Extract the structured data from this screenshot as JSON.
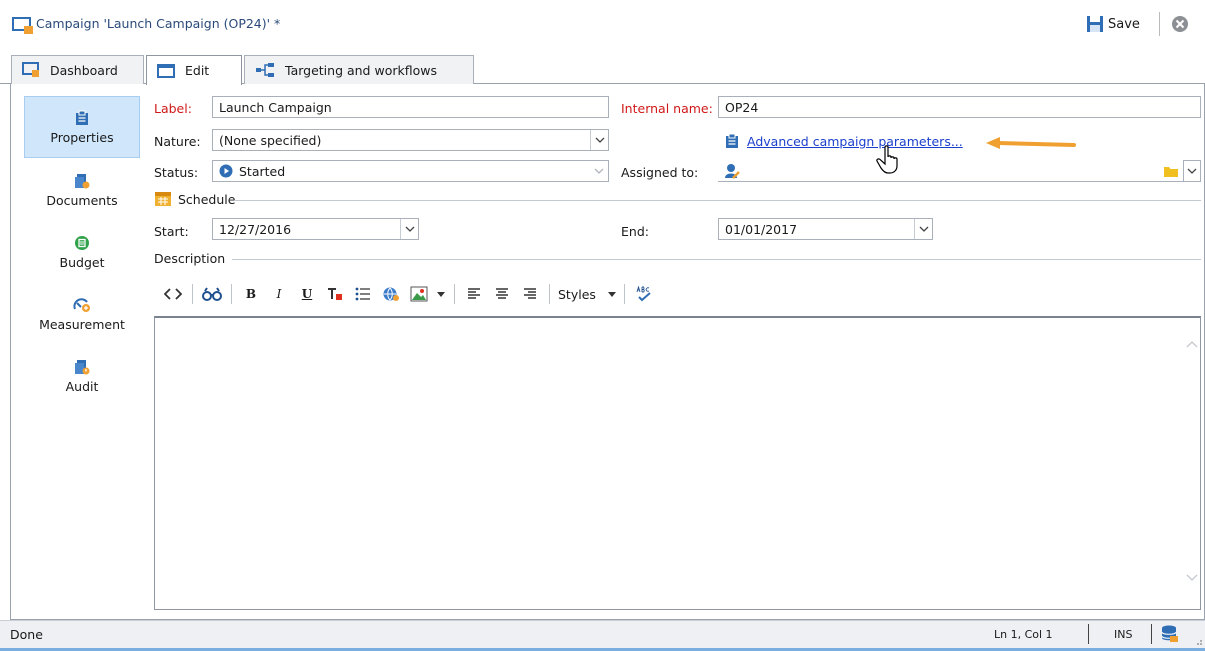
{
  "window": {
    "title": "Campaign 'Launch Campaign (OP24)' *",
    "save_label": "Save"
  },
  "tabs": [
    {
      "label": "Dashboard",
      "icon": "dashboard-icon"
    },
    {
      "label": "Edit",
      "icon": "edit-form-icon",
      "active": true
    },
    {
      "label": "Targeting and workflows",
      "icon": "workflow-icon"
    }
  ],
  "sidebar": {
    "items": [
      {
        "label": "Properties",
        "icon": "clipboard-icon",
        "active": true
      },
      {
        "label": "Documents",
        "icon": "documents-icon"
      },
      {
        "label": "Budget",
        "icon": "budget-icon"
      },
      {
        "label": "Measurement",
        "icon": "measurement-icon"
      },
      {
        "label": "Audit",
        "icon": "audit-icon"
      }
    ]
  },
  "form": {
    "label_caption": "Label:",
    "label_value": "Launch Campaign",
    "internal_name_caption": "Internal name:",
    "internal_name_value": "OP24",
    "nature_caption": "Nature:",
    "nature_value": "(None specified)",
    "advanced_link": "Advanced campaign parameters...",
    "status_caption": "Status:",
    "status_value": "Started",
    "assigned_caption": "Assigned to:",
    "assigned_value": "",
    "schedule_caption": "Schedule",
    "start_caption": "Start:",
    "start_value": "12/27/2016",
    "end_caption": "End:",
    "end_value": "01/01/2017",
    "description_caption": "Description",
    "description_value": ""
  },
  "toolbar": {
    "bold": "B",
    "italic": "I",
    "underline": "U",
    "styles_label": "Styles"
  },
  "statusbar": {
    "status": "Done",
    "position": "Ln 1, Col 1",
    "mode": "INS"
  },
  "colors": {
    "accent_arrow": "#f0a030",
    "link": "#1a3fcc",
    "required_label": "#d01818",
    "selected_bg": "#cfe6fb"
  }
}
